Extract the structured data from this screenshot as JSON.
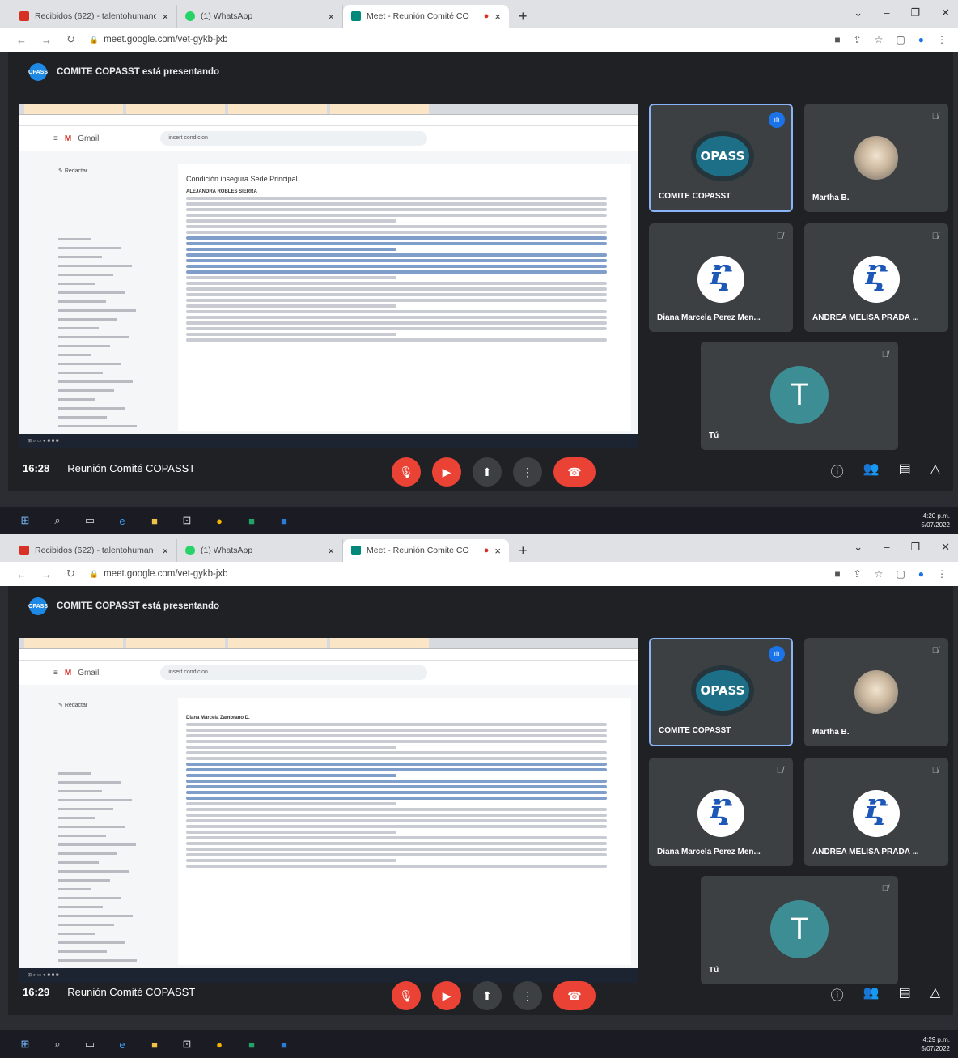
{
  "screenshots": [
    {
      "browser": {
        "tabs": [
          {
            "label": "Recibidos (622) - talentohumano",
            "close": "×",
            "fav_color": "#d93025"
          },
          {
            "label": "(1) WhatsApp",
            "close": "×",
            "fav_color": "#25d366"
          },
          {
            "label": "Meet - Reunión Comité CO",
            "close": "×",
            "fav_color": "#00897b"
          }
        ],
        "new_tab": "+",
        "url": "meet.google.com/vet-gykb-jxb"
      },
      "meet": {
        "presenting_text": "COMITE COPASST está presentando",
        "presenter_avatar": "OPASS",
        "shared_screen": {
          "gmail_label": "Gmail",
          "search_value": "insert condicion",
          "compose": "Redactar",
          "subject": "Condición insegura Sede Principal",
          "sender": "ALEJANDRA ROBLES SIERRA"
        },
        "participants": [
          {
            "name": "COMITE COPASST",
            "avatar": "OPASS",
            "speaking": true
          },
          {
            "name": "Martha B.",
            "avatar": "photo"
          },
          {
            "name": "Diana Marcela Perez Men...",
            "avatar": "logo"
          },
          {
            "name": "ANDREA MELISA PRADA ...",
            "avatar": "logo"
          },
          {
            "name": "Tú",
            "avatar": "T"
          }
        ],
        "time": "16:28",
        "meeting_title": "Reunión Comité COPASST"
      },
      "taskbar": {
        "clock_time": "4:20 p.m.",
        "clock_date": "5/07/2022"
      }
    },
    {
      "browser": {
        "tabs": [
          {
            "label": "Recibidos (622) - talentohuman",
            "close": "×",
            "fav_color": "#d93025"
          },
          {
            "label": "(1) WhatsApp",
            "close": "×",
            "fav_color": "#25d366"
          },
          {
            "label": "Meet - Reunión Comite CO",
            "close": "×",
            "fav_color": "#00897b"
          }
        ],
        "new_tab": "+",
        "url": "meet.google.com/vet-gykb-jxb"
      },
      "meet": {
        "presenting_text": "COMITE COPASST está presentando",
        "presenter_avatar": "OPASS",
        "shared_screen": {
          "gmail_label": "Gmail",
          "search_value": "insert condicion",
          "compose": "Redactar",
          "subject": "",
          "sender": "Diana Marcela Zambrano D."
        },
        "participants": [
          {
            "name": "COMITE COPASST",
            "avatar": "OPASS",
            "speaking": true
          },
          {
            "name": "Martha B.",
            "avatar": "photo"
          },
          {
            "name": "Diana Marcela Perez Men...",
            "avatar": "logo"
          },
          {
            "name": "ANDREA MELISA PRADA ...",
            "avatar": "logo"
          },
          {
            "name": "Tú",
            "avatar": "T"
          }
        ],
        "time": "16:29",
        "meeting_title": "Reunión Comité COPASST"
      },
      "taskbar": {
        "clock_time": "4:29 p.m.",
        "clock_date": "5/07/2022"
      }
    }
  ],
  "colors": {
    "meet_bg": "#202124",
    "tile_bg": "#3c4043",
    "end_call": "#ea4335",
    "speaking_border": "#8ab4f8",
    "you_avatar": "#3d8e94"
  }
}
